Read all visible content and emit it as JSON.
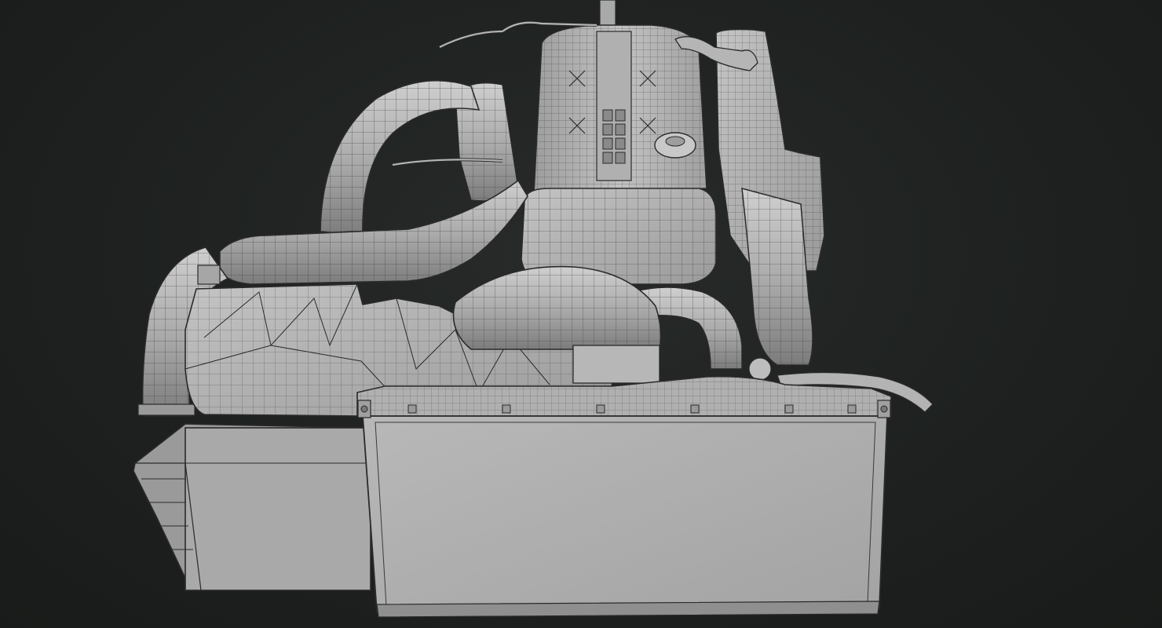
{
  "scene": {
    "subject": "",
    "style": "clay wireframe render",
    "colors": {
      "background": "#1e2120",
      "clay_light": "#b9b9b9",
      "clay_mid": "#9c9c9c",
      "clay_dark": "#6f6f6f",
      "wire": "#2a2a2a"
    },
    "icons": [
      "engine-block-shape",
      "radiator-shape",
      "intercooler-shape",
      "intake-pipe-shape"
    ]
  }
}
